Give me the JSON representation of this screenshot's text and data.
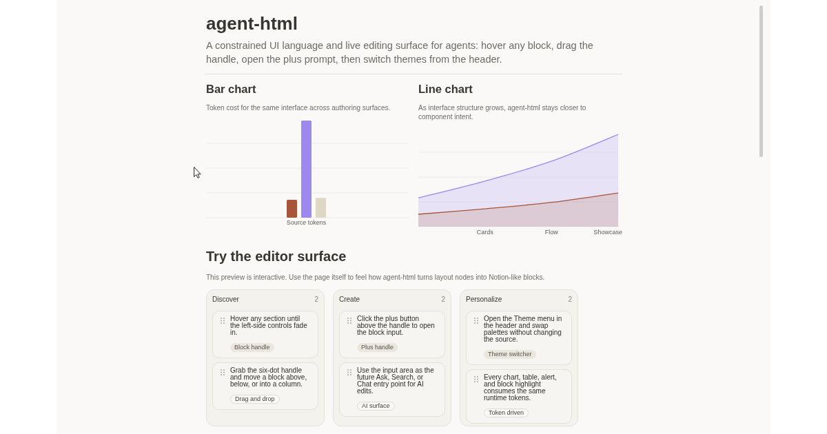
{
  "page": {
    "title": "agent-html",
    "subtitle": "A constrained UI language and live editing surface for agents: hover any block, drag the handle, open the plus prompt, then switch themes from the header."
  },
  "charts": [
    {
      "kind": "bar",
      "heading": "Bar chart",
      "description": "Token cost for the same interface across authoring surfaces.",
      "category_label": "Source tokens"
    },
    {
      "kind": "area",
      "heading": "Line chart",
      "description": "As interface structure grows, agent-html stays closer to component intent.",
      "x_labels": [
        "Cards",
        "Flow",
        "Showcase"
      ]
    }
  ],
  "editor": {
    "heading": "Try the editor surface",
    "description": "This preview is interactive. Use the page itself to feel how agent-html turns layout nodes into Notion-like blocks.",
    "columns": [
      {
        "title": "Discover",
        "count": "2",
        "cards": [
          {
            "text": "Hover any section until the left-side controls fade in.",
            "tag": {
              "label": "Block handle",
              "kind": "filled"
            }
          },
          {
            "text": "Grab the six-dot handle and move a block above, below, or into a column.",
            "tag": {
              "label": "Drag and drop",
              "kind": "outline"
            }
          }
        ]
      },
      {
        "title": "Create",
        "count": "2",
        "cards": [
          {
            "text": "Click the plus button above the handle to open the block input.",
            "tag": {
              "label": "Plus handle",
              "kind": "filled"
            }
          },
          {
            "text": "Use the input area as the future Ask, Search, or Chat entry point for AI edits.",
            "tag": {
              "label": "AI surface",
              "kind": "outline"
            }
          }
        ]
      },
      {
        "title": "Personalize",
        "count": "2",
        "cards": [
          {
            "text": "Open the Theme menu in the header and swap palettes without changing the source.",
            "tag": {
              "label": "Theme switcher",
              "kind": "filled"
            }
          },
          {
            "text": "Every chart, table, alert, and block highlight consumes the same runtime tokens.",
            "tag": {
              "label": "Token driven",
              "kind": "outline"
            }
          }
        ]
      }
    ]
  }
}
